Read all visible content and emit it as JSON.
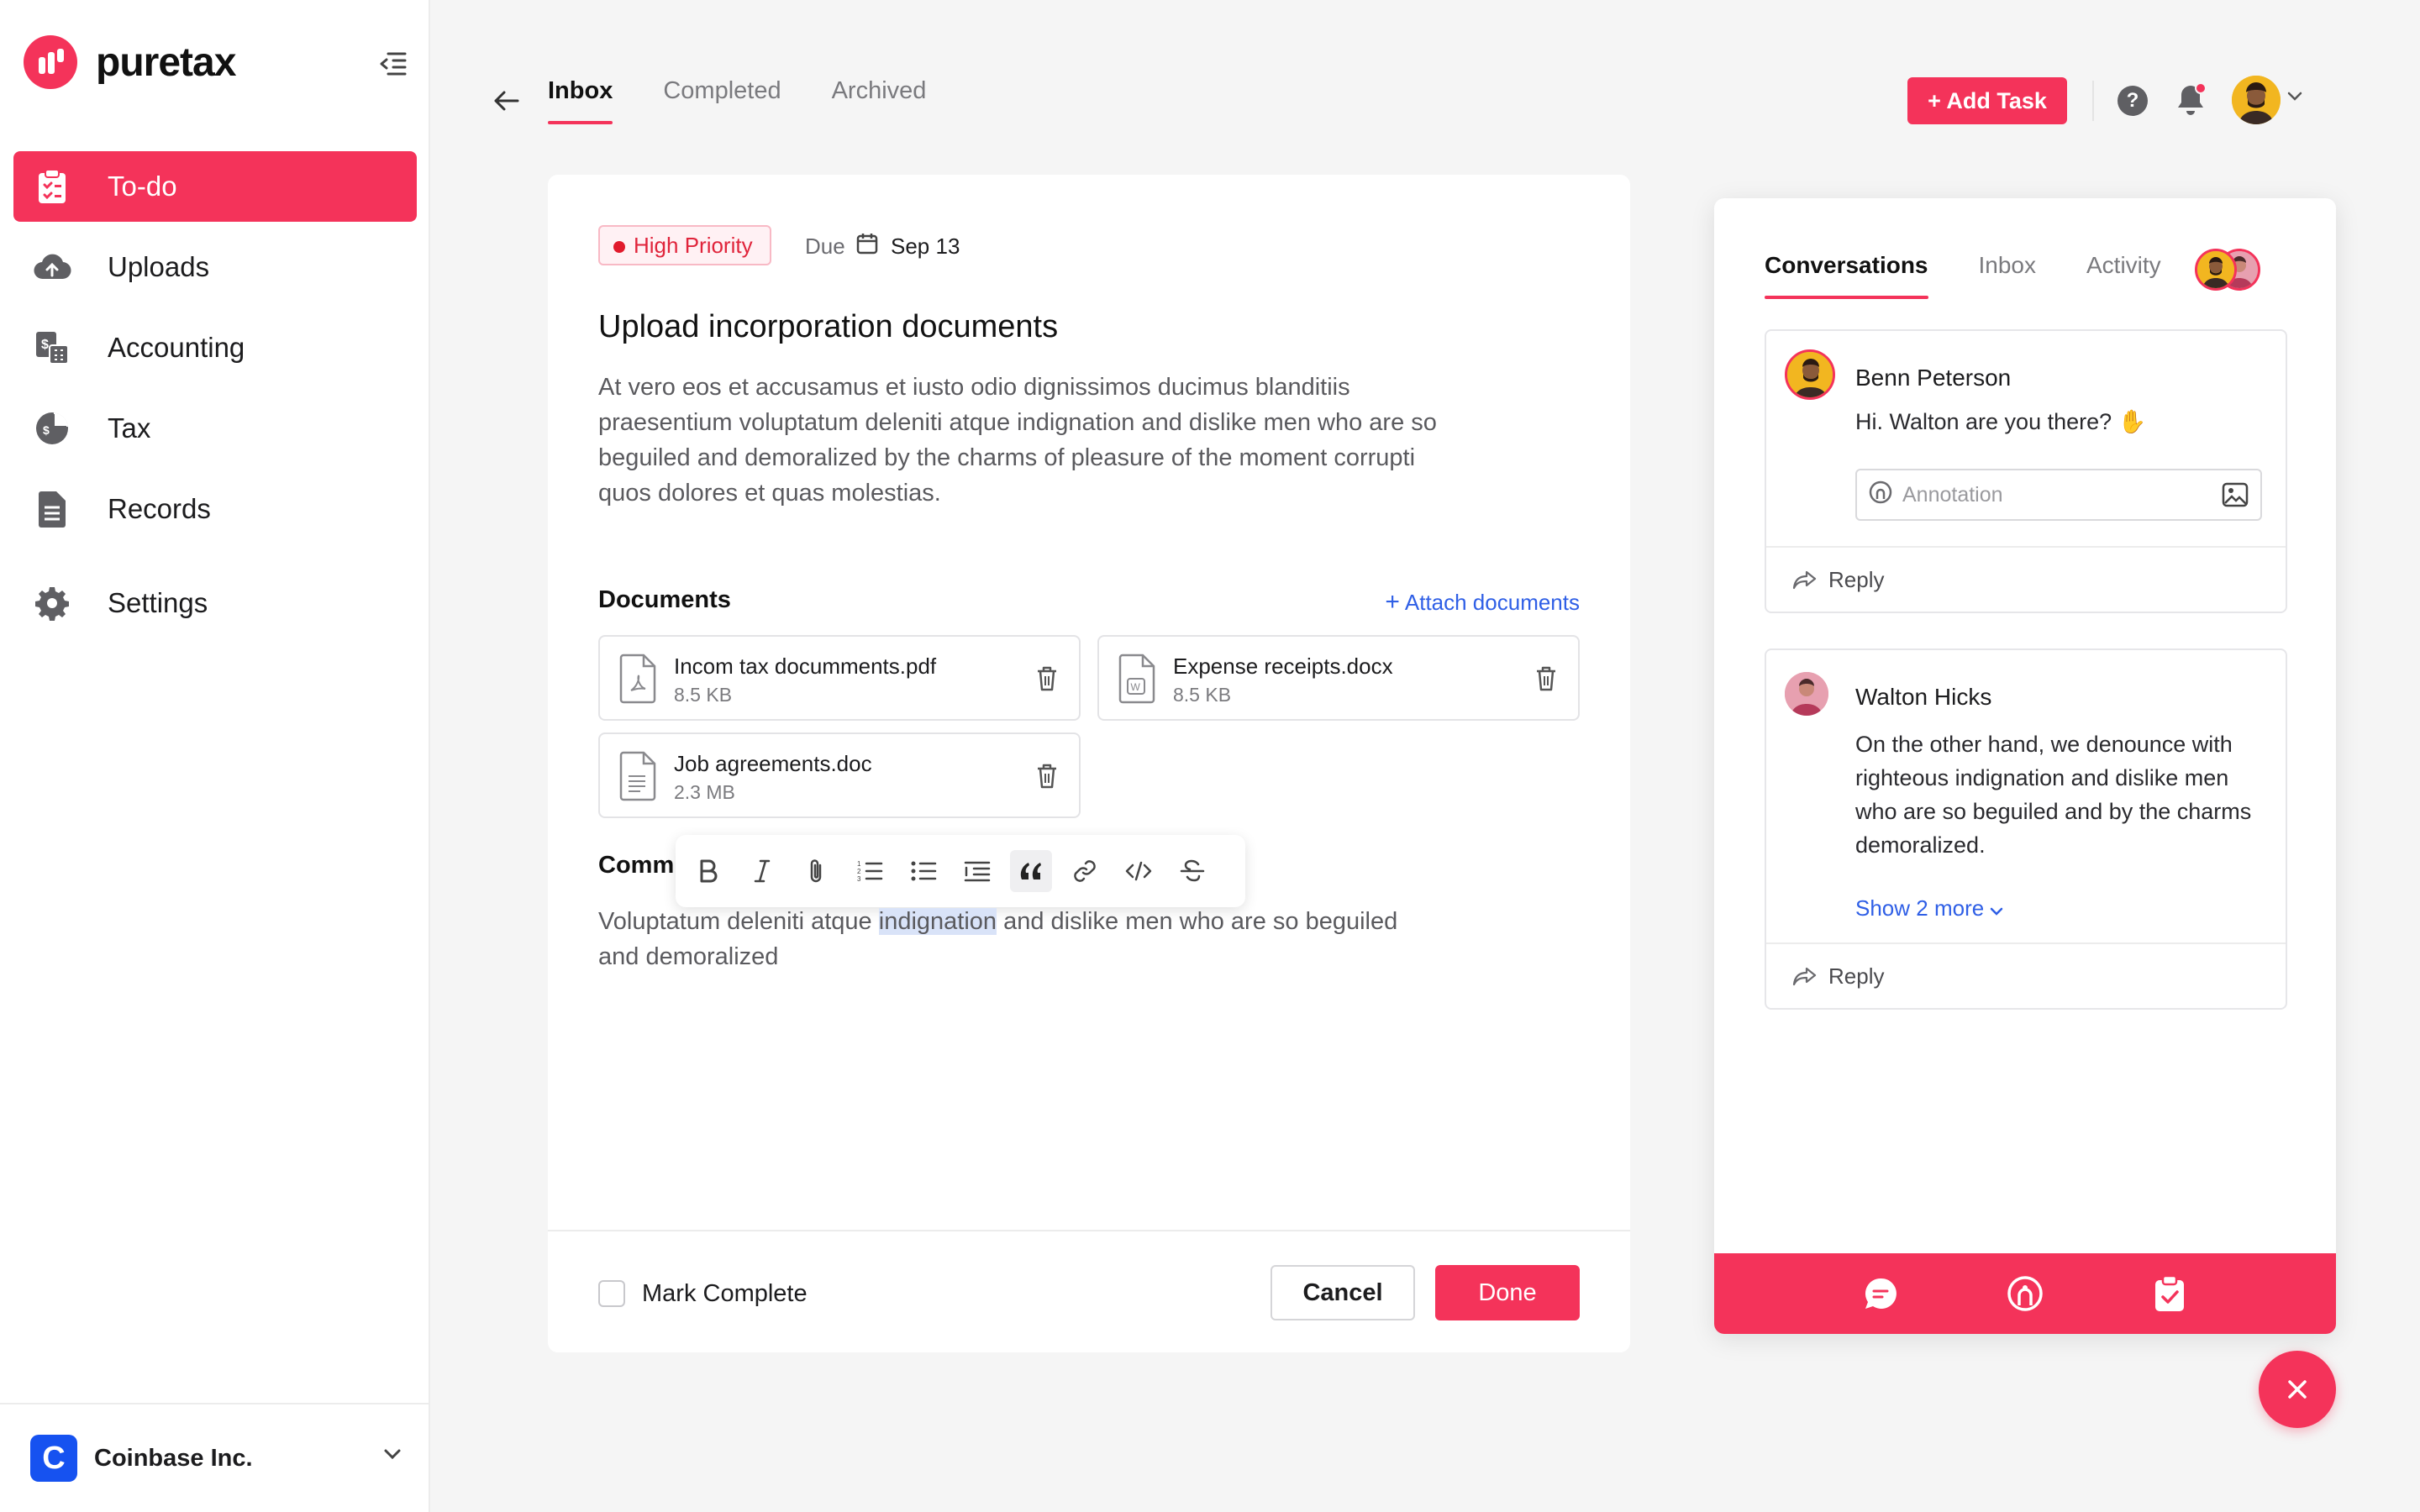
{
  "brand": {
    "name": "puretax",
    "accent": "#f4335a"
  },
  "sidebar": {
    "items": [
      {
        "label": "To-do",
        "icon": "clipboard-list-icon",
        "active": true
      },
      {
        "label": "Uploads",
        "icon": "cloud-upload-icon",
        "active": false
      },
      {
        "label": "Accounting",
        "icon": "calculator-icon",
        "active": false
      },
      {
        "label": "Tax",
        "icon": "pie-chart-icon",
        "active": false
      },
      {
        "label": "Records",
        "icon": "document-list-icon",
        "active": false
      },
      {
        "label": "Settings",
        "icon": "gear-icon",
        "active": false
      }
    ],
    "company": {
      "logo_letter": "C",
      "name": "Coinbase Inc."
    }
  },
  "header": {
    "tabs": [
      {
        "label": "Inbox",
        "active": true
      },
      {
        "label": "Completed",
        "active": false
      },
      {
        "label": "Archived",
        "active": false
      }
    ],
    "add_task_label": "+ Add Task",
    "help_label": "?"
  },
  "task": {
    "priority": "High Priority",
    "due_label": "Due",
    "due_date": "Sep 13",
    "title": "Upload incorporation documents",
    "description": "At vero eos et accusamus et iusto odio dignissimos ducimus blanditiis praesentium voluptatum deleniti atque indignation and dislike men who are so beguiled and demoralized by the charms of pleasure of the moment corrupti quos dolores et quas molestias.",
    "documents_title": "Documents",
    "attach_label": "Attach documents",
    "documents": [
      {
        "name": "Incom tax documments.pdf",
        "size": "8.5 KB",
        "type": "pdf"
      },
      {
        "name": "Expense receipts.docx",
        "size": "8.5 KB",
        "type": "docx"
      },
      {
        "name": "Job agreements.doc",
        "size": "2.3 MB",
        "type": "doc"
      }
    ],
    "comments_label": "Comm",
    "comment_before": "Voluptatum deleniti atque ",
    "comment_highlight": "indignation",
    "comment_after": " and dislike men who are so beguiled and demoralized",
    "toolbar": [
      "bold-icon",
      "italic-icon",
      "attach-icon",
      "ordered-list-icon",
      "bullet-list-icon",
      "indent-icon",
      "quote-icon",
      "link-icon",
      "code-icon",
      "strikethrough-icon"
    ],
    "mark_complete_label": "Mark Complete",
    "cancel_label": "Cancel",
    "done_label": "Done"
  },
  "panel": {
    "tabs": [
      {
        "label": "Conversations",
        "active": true
      },
      {
        "label": "Inbox",
        "active": false
      },
      {
        "label": "Activity",
        "active": false
      }
    ],
    "messages": [
      {
        "author": "Benn Peterson",
        "text": "Hi. Walton are you there? ✋",
        "annotation_placeholder": "Annotation",
        "reply_label": "Reply"
      },
      {
        "author": "Walton Hicks",
        "text": "On the other hand, we denounce with righteous indignation and dislike men who are so beguiled and by the charms demoralized.",
        "show_more": "Show 2 more",
        "reply_label": "Reply"
      }
    ],
    "bottom_icons": [
      "chat-icon",
      "annotation-icon",
      "clipboard-check-icon"
    ]
  }
}
